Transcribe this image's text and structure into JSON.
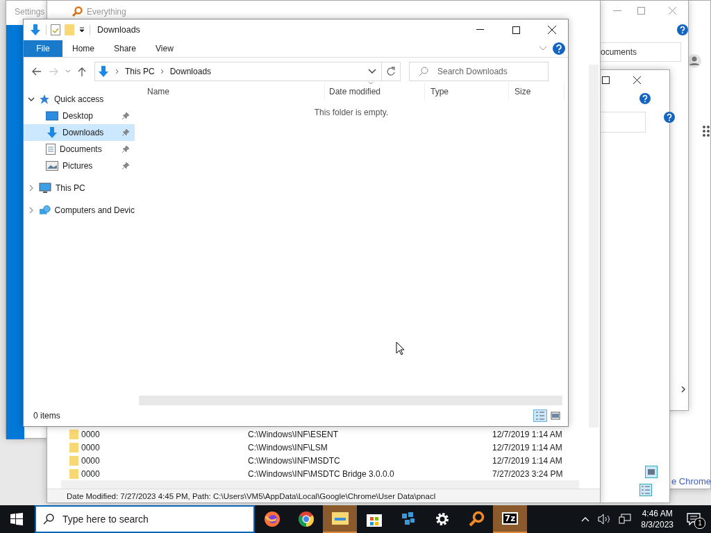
{
  "settings_window": {
    "title": "Settings"
  },
  "everything_window": {
    "title": "Everything",
    "rows": [
      {
        "name": "0000",
        "path": "C:\\Windows\\INF\\ESENT",
        "date": "12/7/2019 1:14 AM"
      },
      {
        "name": "0000",
        "path": "C:\\Windows\\INF\\LSM",
        "date": "12/7/2019 1:14 AM"
      },
      {
        "name": "0000",
        "path": "C:\\Windows\\INF\\MSDTC",
        "date": "12/7/2019 1:14 AM"
      },
      {
        "name": "0000",
        "path": "C:\\Windows\\INF\\MSDTC Bridge 3.0.0.0",
        "date": "7/27/2023 3:24 PM"
      }
    ],
    "status_bar": "Date Modified: 7/27/2023 4:45 PM, Path: C:\\Users\\VM5\\AppData\\Local\\Google\\Chrome\\User Data\\pnacl"
  },
  "back_windows": {
    "address_fragment": "ocuments",
    "link_fragment": "e Chrome"
  },
  "explorer": {
    "title": "Downloads",
    "ribbon_tabs": [
      {
        "label": "File",
        "kind": "file"
      },
      {
        "label": "Home",
        "kind": "tab"
      },
      {
        "label": "Share",
        "kind": "tab"
      },
      {
        "label": "View",
        "kind": "tab"
      }
    ],
    "breadcrumb": [
      "This PC",
      "Downloads"
    ],
    "search": {
      "placeholder": "Search Downloads"
    },
    "nav_tree": [
      {
        "label": "Quick access",
        "expanded": true,
        "children": [
          {
            "label": "Desktop",
            "selected": false,
            "pinned": true
          },
          {
            "label": "Downloads",
            "selected": true,
            "pinned": true
          },
          {
            "label": "Documents",
            "selected": false,
            "pinned": true
          },
          {
            "label": "Pictures",
            "selected": false,
            "pinned": true
          }
        ]
      },
      {
        "label": "This PC",
        "expanded": false
      },
      {
        "label": "Computers and Devic",
        "expanded": false
      }
    ],
    "columns": [
      {
        "label": "Name",
        "sorted": false
      },
      {
        "label": "Date modified",
        "sorted": true
      },
      {
        "label": "Type",
        "sorted": false
      },
      {
        "label": "Size",
        "sorted": false
      }
    ],
    "empty_message": "This folder is empty.",
    "status": "0 items",
    "views": [
      {
        "kind": "details",
        "selected": true
      },
      {
        "kind": "large",
        "selected": false
      }
    ]
  },
  "taskbar": {
    "search": {
      "placeholder": "Type here to search"
    },
    "apps": [
      {
        "kind": "firefox",
        "highlighted": false
      },
      {
        "kind": "chrome",
        "highlighted": false
      },
      {
        "kind": "explorer",
        "highlighted": true
      },
      {
        "kind": "store",
        "highlighted": false
      },
      {
        "kind": "cube",
        "highlighted": false
      },
      {
        "kind": "settings",
        "highlighted": false
      },
      {
        "kind": "everything",
        "highlighted": false
      },
      {
        "kind": "sevenzip",
        "label": "7z",
        "highlighted": true
      }
    ],
    "time": "4:46 AM",
    "date": "8/3/2023",
    "notifications": "1"
  }
}
